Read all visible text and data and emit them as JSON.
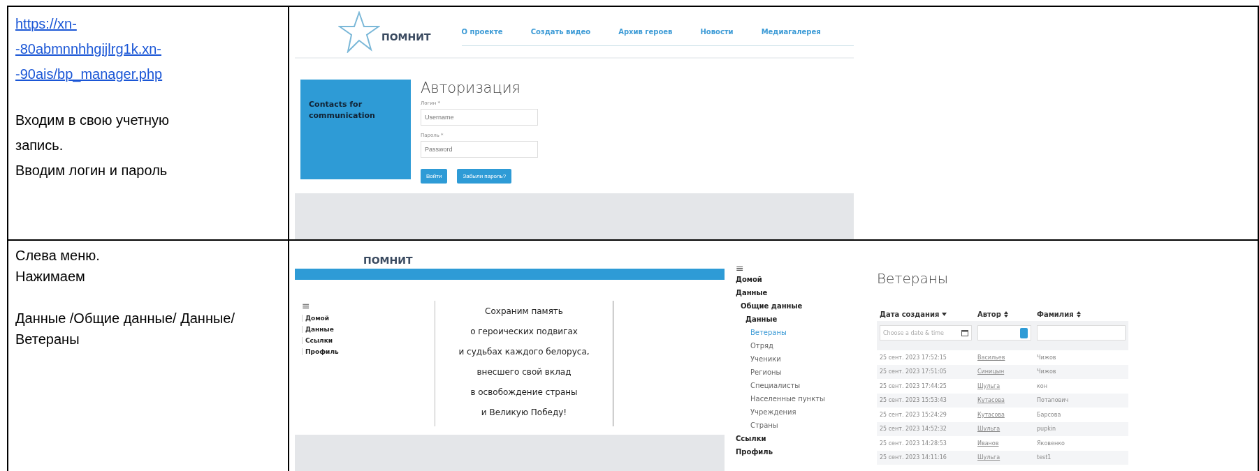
{
  "login_step": {
    "link": "https://xn--80abmnnhhgijlrg1k.xn--90ais/bp_manager.php",
    "paragraphs": [
      "Входим в свою учетную запись.",
      "Вводим логин и пароль"
    ],
    "screenshot": {
      "logo": "ПОМНИТ",
      "nav": [
        "О проекте",
        "Создать видео",
        "Архив героев",
        "Новости",
        "Медиагалерея"
      ],
      "contacts_title": "Contacts for communication",
      "title": "Авторизация",
      "fields": [
        {
          "label": "Логин *",
          "placeholder": "Username"
        },
        {
          "label": "Пароль *",
          "placeholder": "Password"
        }
      ],
      "buttons": [
        "Войти",
        "Забыли пароль?"
      ]
    }
  },
  "menu_step": {
    "paragraphs": [
      "Слева меню.",
      "Нажимаем",
      "Данные /Общие данные/ Данные/Ветераны"
    ],
    "home_screenshot": {
      "logo": "ПОМНИТ",
      "menu_icon": "≡",
      "menu": [
        "Домой",
        "Данные",
        "Ссылки",
        "Профиль"
      ],
      "slogan": [
        "Сохраним память",
        "о героических подвигах",
        "и судьбах каждого белоруса,",
        "внесшего свой вклад",
        "в освобождение страны",
        "и Великую Победу!"
      ]
    },
    "veterans_screenshot": {
      "menu_icon": "≡",
      "menu": [
        {
          "label": "Домой",
          "selected": false
        },
        {
          "label": "Данные",
          "selected": false,
          "children": [
            {
              "label": "Общие данные",
              "selected": false,
              "children": [
                {
                  "label": "Данные",
                  "selected": false,
                  "children": [
                    {
                      "label": "Ветераны",
                      "selected": true
                    },
                    {
                      "label": "Отряд",
                      "selected": false
                    },
                    {
                      "label": "Ученики",
                      "selected": false
                    },
                    {
                      "label": "Регионы",
                      "selected": false
                    },
                    {
                      "label": "Специалисты",
                      "selected": false
                    },
                    {
                      "label": "Населенные пункты",
                      "selected": false
                    },
                    {
                      "label": "Учреждения",
                      "selected": false
                    },
                    {
                      "label": "Страны",
                      "selected": false
                    }
                  ]
                }
              ]
            }
          ]
        },
        {
          "label": "Ссылки",
          "selected": false
        },
        {
          "label": "Профиль",
          "selected": false
        }
      ],
      "title": "Ветераны",
      "columns": [
        {
          "label": "Дата создания",
          "sorted": true
        },
        {
          "label": "Автор",
          "sorted": false
        },
        {
          "label": "Фамилия",
          "sorted": false
        }
      ],
      "date_placeholder": "Choose a date & time",
      "rows": [
        [
          "25 сент. 2023 17:52:15",
          "Васильев",
          "Чижов"
        ],
        [
          "25 сент. 2023 17:51:05",
          "Синицын",
          "Чижов"
        ],
        [
          "25 сент. 2023 17:44:25",
          "Шульга",
          "кон"
        ],
        [
          "25 сент. 2023 15:53:43",
          "Кутасова",
          "Потапович"
        ],
        [
          "25 сент. 2023 15:24:29",
          "Кутасова",
          "Барсова"
        ],
        [
          "25 сент. 2023 14:52:32",
          "Шульга",
          "pupkin"
        ],
        [
          "25 сент. 2023 14:28:53",
          "Иванов",
          "Яковенко"
        ],
        [
          "25 сент. 2023 14:11:16",
          "Шульга",
          "test1"
        ]
      ]
    }
  }
}
